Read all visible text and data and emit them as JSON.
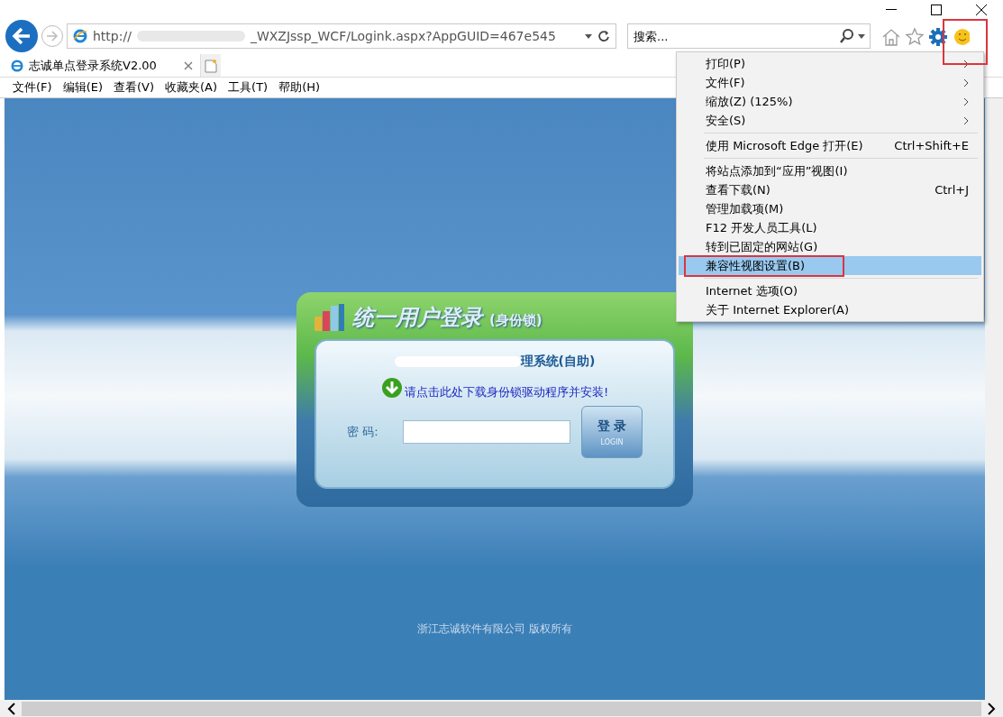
{
  "browser": {
    "address": {
      "prefix": "http://",
      "suffix": "_WXZJssp_WCF/Logink.aspx?AppGUID=467e545"
    },
    "search": {
      "placeholder": "搜索..."
    },
    "tabs": [
      {
        "label": "志诚单点登录系统V2.00",
        "selected": true
      }
    ],
    "menu_bar": [
      "文件(F)",
      "编辑(E)",
      "查看(V)",
      "收藏夹(A)",
      "工具(T)",
      "帮助(H)"
    ]
  },
  "tools_menu": [
    {
      "kind": "item",
      "label": "打印(P)",
      "submenu": true,
      "selected": false
    },
    {
      "kind": "item",
      "label": "文件(F)",
      "submenu": true,
      "selected": false
    },
    {
      "kind": "item",
      "label": "缩放(Z) (125%)",
      "submenu": true,
      "selected": false
    },
    {
      "kind": "item",
      "label": "安全(S)",
      "submenu": true,
      "selected": false
    },
    {
      "kind": "separator"
    },
    {
      "kind": "item",
      "label": "使用 Microsoft Edge 打开(E)",
      "shortcut": "Ctrl+Shift+E",
      "submenu": false,
      "selected": false
    },
    {
      "kind": "separator"
    },
    {
      "kind": "item",
      "label": "将站点添加到“应用”视图(I)",
      "submenu": false,
      "selected": false
    },
    {
      "kind": "item",
      "label": "查看下载(N)",
      "shortcut": "Ctrl+J",
      "submenu": false,
      "selected": false
    },
    {
      "kind": "item",
      "label": "管理加载项(M)",
      "submenu": false,
      "selected": false
    },
    {
      "kind": "item",
      "label": "F12 开发人员工具(L)",
      "submenu": false,
      "selected": false
    },
    {
      "kind": "item",
      "label": "转到已固定的网站(G)",
      "submenu": false,
      "selected": false
    },
    {
      "kind": "item",
      "label": "兼容性视图设置(B)",
      "submenu": false,
      "selected": true
    },
    {
      "kind": "separator"
    },
    {
      "kind": "item",
      "label": "Internet 选项(O)",
      "submenu": false,
      "selected": false
    },
    {
      "kind": "item",
      "label": "关于 Internet Explorer(A)",
      "submenu": false,
      "selected": false
    }
  ],
  "login": {
    "title": "统一用户登录",
    "subtitle": "(身份锁)",
    "system_name": "理系统(自助)",
    "download_link": "请点击此处下载身份锁驱动程序并安装!",
    "password_label": "密 码:",
    "login_button": {
      "label": "登 录",
      "sublabel": "LOGIN"
    }
  },
  "footer": "浙江志诚软件有限公司 版权所有"
}
